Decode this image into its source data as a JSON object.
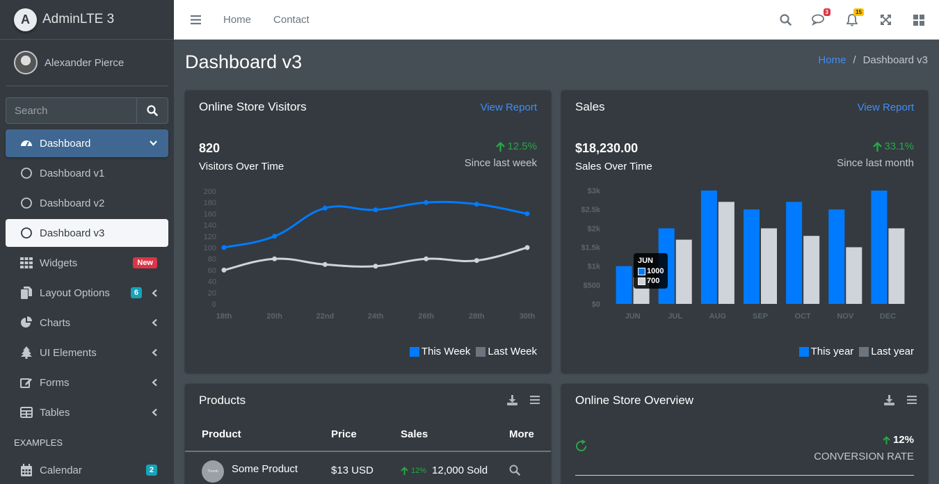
{
  "brand": {
    "name": "AdminLTE 3",
    "logo_letter": "A"
  },
  "user": {
    "name": "Alexander Pierce"
  },
  "sidebar_search": {
    "placeholder": "Search"
  },
  "sidebar": {
    "dashboard": "Dashboard",
    "dashboard_v1": "Dashboard v1",
    "dashboard_v2": "Dashboard v2",
    "dashboard_v3": "Dashboard v3",
    "widgets": "Widgets",
    "widgets_badge": "New",
    "layout_options": "Layout Options",
    "layout_badge": "6",
    "charts": "Charts",
    "ui_elements": "UI Elements",
    "forms": "Forms",
    "tables": "Tables",
    "examples_header": "EXAMPLES",
    "calendar": "Calendar",
    "calendar_badge": "2"
  },
  "topbar": {
    "home": "Home",
    "contact": "Contact",
    "messages_count": "3",
    "notifications_count": "15"
  },
  "page": {
    "title": "Dashboard v3"
  },
  "breadcrumb": {
    "home": "Home",
    "sep": "/",
    "current": "Dashboard v3"
  },
  "visitors_card": {
    "title": "Online Store Visitors",
    "link": "View Report",
    "value": "820",
    "label": "Visitors Over Time",
    "change": "12.5%",
    "since": "Since last week"
  },
  "sales_card": {
    "title": "Sales",
    "link": "View Report",
    "value": "$18,230.00",
    "label": "Sales Over Time",
    "change": "33.1%",
    "since": "Since last month"
  },
  "products_card": {
    "title": "Products",
    "headers": {
      "product": "Product",
      "price": "Price",
      "sales": "Sales",
      "more": "More"
    },
    "rows": [
      {
        "name": "Some Product",
        "img_text": "Thumb",
        "price": "$13 USD",
        "change": "12%",
        "sold": "12,000 Sold"
      }
    ]
  },
  "overview_card": {
    "title": "Online Store Overview",
    "conversion_value": "12%",
    "conversion_label": "CONVERSION RATE"
  },
  "colors": {
    "primary": "#007bff",
    "gray": "#ced4da",
    "success": "#28a745",
    "link": "#3f8ef5"
  },
  "chart_data": [
    {
      "type": "line",
      "x": [
        "18th",
        "20th",
        "22nd",
        "24th",
        "26th",
        "28th",
        "30th"
      ],
      "series": [
        {
          "name": "This Week",
          "color": "#007bff",
          "values": [
            100,
            120,
            170,
            167,
            180,
            177,
            160
          ]
        },
        {
          "name": "Last Week",
          "color": "#ced4da",
          "values": [
            60,
            80,
            70,
            67,
            80,
            77,
            100
          ]
        }
      ],
      "yticks": [
        "0",
        "20",
        "40",
        "60",
        "80",
        "100",
        "120",
        "140",
        "160",
        "180",
        "200"
      ],
      "ylim": [
        0,
        200
      ],
      "legend": [
        "This Week",
        "Last Week"
      ],
      "legend_colors": [
        "#007bff",
        "#6c757d"
      ],
      "legend_position": "bottom-right"
    },
    {
      "type": "bar",
      "categories": [
        "JUN",
        "JUL",
        "AUG",
        "SEP",
        "OCT",
        "NOV",
        "DEC"
      ],
      "series": [
        {
          "name": "This year",
          "color": "#007bff",
          "values": [
            1000,
            2000,
            3000,
            2500,
            2700,
            2500,
            3000
          ]
        },
        {
          "name": "Last year",
          "color": "#ced4da",
          "values": [
            700,
            1700,
            2700,
            2000,
            1800,
            1500,
            2000
          ]
        }
      ],
      "yticks": [
        "$0",
        "$500",
        "$1k",
        "$1.5k",
        "$2k",
        "$2.5k",
        "$3k"
      ],
      "ylim": [
        0,
        3000
      ],
      "legend": [
        "This year",
        "Last year"
      ],
      "legend_colors": [
        "#007bff",
        "#6c757d"
      ],
      "legend_position": "bottom-right",
      "tooltip": {
        "title": "JUN",
        "values": [
          "1000",
          "700"
        ]
      }
    }
  ]
}
